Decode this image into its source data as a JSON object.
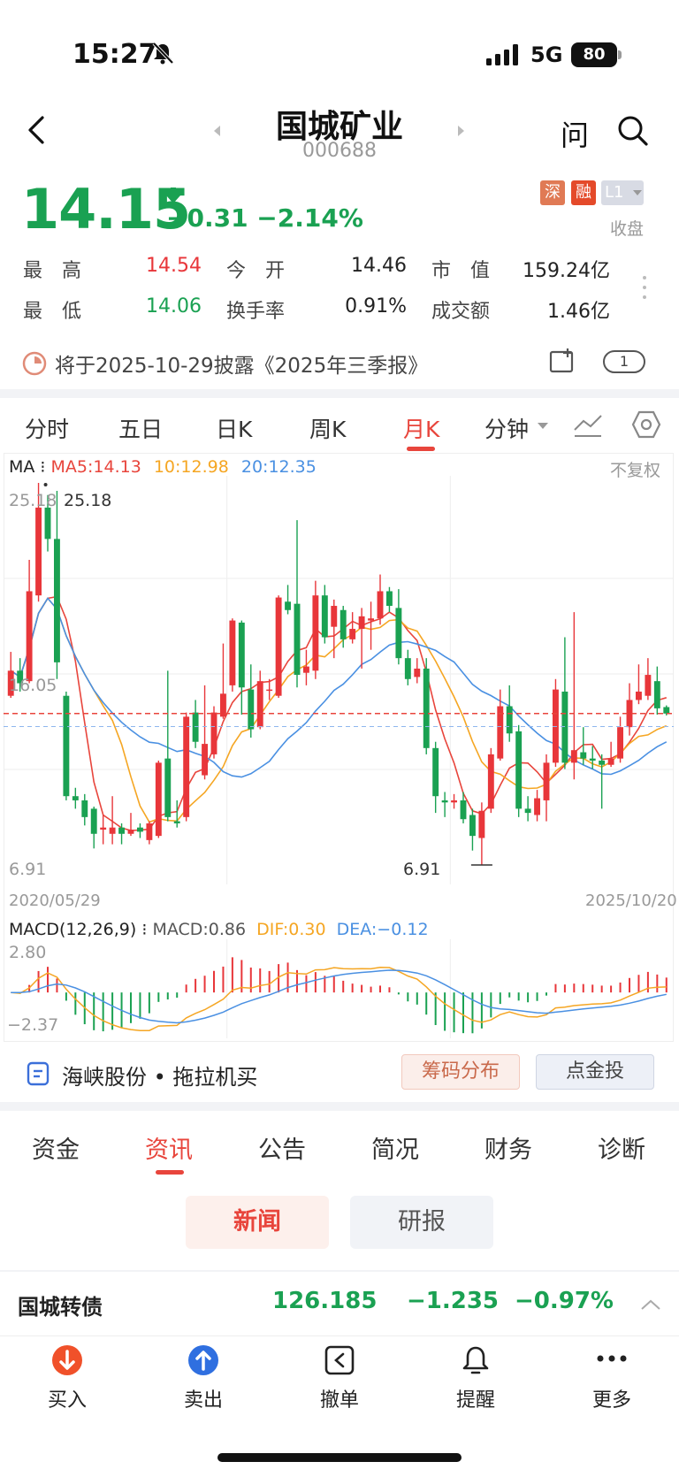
{
  "status_bar": {
    "time": "15:27",
    "network": "5G",
    "battery": "80"
  },
  "header": {
    "title": "国城矿业",
    "code": "000688",
    "ask_label": "问"
  },
  "quote": {
    "price": "14.15",
    "change": "−0.31",
    "change_pct": "−2.14%",
    "tags": [
      "深",
      "融",
      "L1"
    ],
    "market_status": "收盘",
    "stats": [
      {
        "label": "最　高",
        "value": "14.54"
      },
      {
        "label": "今　开",
        "value": "14.46"
      },
      {
        "label": "市　值",
        "value": "159.24亿"
      },
      {
        "label": "最　低",
        "value": "14.06"
      },
      {
        "label": "换手率",
        "value": "0.91%"
      },
      {
        "label": "成交额",
        "value": "1.46亿"
      }
    ]
  },
  "notice": {
    "text": "将于2025-10-29披露《2025年三季报》",
    "pill": "1"
  },
  "chart_tabs": [
    "分时",
    "五日",
    "日K",
    "周K",
    "月K",
    "分钟"
  ],
  "ma_legend": {
    "prefix": "MA",
    "ma5": "MA5:14.13",
    "ma10": "10:12.98",
    "ma20": "20:12.35",
    "adjust": "不复权"
  },
  "chart_axis": {
    "top": "25.18",
    "mid": "16.05",
    "bottom": "6.91",
    "high_mark": "25.18",
    "low_mark": "6.91",
    "start_date": "2020/05/29",
    "end_date": "2025/10/20"
  },
  "macd_legend": {
    "name": "MACD(12,26,9)",
    "macd": "MACD:0.86",
    "dif": "DIF:0.30",
    "dea": "DEA:−0.12",
    "top": "2.80",
    "bottom": "−2.37"
  },
  "colors": {
    "up": "#e8363a",
    "down": "#1aa152",
    "ma5": "#e8453c",
    "ma10": "#f5a623",
    "ma20": "#4a90e2",
    "accent": "#e8453c"
  },
  "chart_data": {
    "type": "candlestick",
    "title": "",
    "period": "monthly",
    "x_range": [
      "2020/05/29",
      "2025/10/20"
    ],
    "ylim": [
      6.91,
      25.18
    ],
    "candles": [
      {
        "o": 15.0,
        "c": 16.2,
        "h": 17.1,
        "l": 14.9
      },
      {
        "o": 16.2,
        "c": 15.6,
        "h": 16.8,
        "l": 15.2
      },
      {
        "o": 15.7,
        "c": 20.0,
        "h": 21.5,
        "l": 15.6
      },
      {
        "o": 19.8,
        "c": 24.0,
        "h": 25.18,
        "l": 19.5
      },
      {
        "o": 24.0,
        "c": 22.5,
        "h": 24.6,
        "l": 21.9
      },
      {
        "o": 22.5,
        "c": 16.6,
        "h": 24.8,
        "l": 15.8
      },
      {
        "o": 15.0,
        "c": 10.2,
        "h": 15.2,
        "l": 10.0
      },
      {
        "o": 10.2,
        "c": 10.0,
        "h": 10.6,
        "l": 9.6
      },
      {
        "o": 10.0,
        "c": 9.2,
        "h": 10.3,
        "l": 8.8
      },
      {
        "o": 9.6,
        "c": 8.4,
        "h": 9.7,
        "l": 7.7
      },
      {
        "o": 8.6,
        "c": 8.7,
        "h": 9.3,
        "l": 7.9
      },
      {
        "o": 8.4,
        "c": 8.7,
        "h": 10.2,
        "l": 7.9
      },
      {
        "o": 8.7,
        "c": 8.4,
        "h": 8.9,
        "l": 7.9
      },
      {
        "o": 8.4,
        "c": 8.6,
        "h": 9.4,
        "l": 8.3
      },
      {
        "o": 8.7,
        "c": 8.5,
        "h": 8.9,
        "l": 8.2
      },
      {
        "o": 8.1,
        "c": 8.9,
        "h": 9.0,
        "l": 7.9
      },
      {
        "o": 8.3,
        "c": 11.8,
        "h": 11.9,
        "l": 8.2
      },
      {
        "o": 12.0,
        "c": 9.2,
        "h": 16.2,
        "l": 9.0
      },
      {
        "o": 9.0,
        "c": 8.9,
        "h": 10.0,
        "l": 8.7
      },
      {
        "o": 9.2,
        "c": 14.0,
        "h": 14.2,
        "l": 9.0
      },
      {
        "o": 14.2,
        "c": 12.8,
        "h": 14.8,
        "l": 12.5
      },
      {
        "o": 11.2,
        "c": 12.7,
        "h": 15.5,
        "l": 11.0
      },
      {
        "o": 12.2,
        "c": 14.2,
        "h": 14.5,
        "l": 12.0
      },
      {
        "o": 14.0,
        "c": 15.1,
        "h": 17.5,
        "l": 13.9
      },
      {
        "o": 15.5,
        "c": 18.6,
        "h": 18.7,
        "l": 15.2
      },
      {
        "o": 18.5,
        "c": 15.4,
        "h": 18.6,
        "l": 14.1
      },
      {
        "o": 15.3,
        "c": 13.4,
        "h": 16.5,
        "l": 13.0
      },
      {
        "o": 13.5,
        "c": 15.7,
        "h": 16.2,
        "l": 13.4
      },
      {
        "o": 15.3,
        "c": 15.3,
        "h": 15.8,
        "l": 14.8
      },
      {
        "o": 15.0,
        "c": 19.7,
        "h": 19.8,
        "l": 14.9
      },
      {
        "o": 19.5,
        "c": 19.1,
        "h": 20.3,
        "l": 18.9
      },
      {
        "o": 19.4,
        "c": 16.0,
        "h": 23.4,
        "l": 15.4
      },
      {
        "o": 16.1,
        "c": 16.4,
        "h": 17.2,
        "l": 15.5
      },
      {
        "o": 16.2,
        "c": 19.8,
        "h": 20.5,
        "l": 15.8
      },
      {
        "o": 19.8,
        "c": 17.8,
        "h": 20.3,
        "l": 17.5
      },
      {
        "o": 18.3,
        "c": 19.3,
        "h": 19.6,
        "l": 16.8
      },
      {
        "o": 19.1,
        "c": 17.7,
        "h": 19.3,
        "l": 17.3
      },
      {
        "o": 17.7,
        "c": 18.2,
        "h": 19.0,
        "l": 17.5
      },
      {
        "o": 18.2,
        "c": 18.8,
        "h": 19.2,
        "l": 16.3
      },
      {
        "o": 18.6,
        "c": 18.7,
        "h": 19.5,
        "l": 17.2
      },
      {
        "o": 18.7,
        "c": 20.0,
        "h": 20.8,
        "l": 18.4
      },
      {
        "o": 20.0,
        "c": 19.3,
        "h": 20.2,
        "l": 19.0
      },
      {
        "o": 19.2,
        "c": 16.8,
        "h": 20.1,
        "l": 16.5
      },
      {
        "o": 16.8,
        "c": 15.8,
        "h": 17.2,
        "l": 15.5
      },
      {
        "o": 15.9,
        "c": 16.3,
        "h": 16.8,
        "l": 15.6
      },
      {
        "o": 16.3,
        "c": 12.5,
        "h": 16.8,
        "l": 12.2
      },
      {
        "o": 12.5,
        "c": 10.2,
        "h": 12.8,
        "l": 9.4
      },
      {
        "o": 10.0,
        "c": 9.9,
        "h": 10.4,
        "l": 9.2
      },
      {
        "o": 9.9,
        "c": 10.0,
        "h": 10.3,
        "l": 9.6
      },
      {
        "o": 10.0,
        "c": 9.1,
        "h": 10.4,
        "l": 8.9
      },
      {
        "o": 9.3,
        "c": 8.3,
        "h": 9.6,
        "l": 7.6
      },
      {
        "o": 8.2,
        "c": 9.5,
        "h": 9.9,
        "l": 6.91
      },
      {
        "o": 9.6,
        "c": 12.2,
        "h": 12.5,
        "l": 9.4
      },
      {
        "o": 12.0,
        "c": 14.5,
        "h": 15.3,
        "l": 11.9
      },
      {
        "o": 14.5,
        "c": 13.2,
        "h": 15.5,
        "l": 12.8
      },
      {
        "o": 13.3,
        "c": 9.6,
        "h": 13.6,
        "l": 9.2
      },
      {
        "o": 9.6,
        "c": 9.4,
        "h": 10.2,
        "l": 9.0
      },
      {
        "o": 9.3,
        "c": 10.1,
        "h": 10.5,
        "l": 9.0
      },
      {
        "o": 10.0,
        "c": 11.8,
        "h": 12.2,
        "l": 9.0
      },
      {
        "o": 11.8,
        "c": 15.3,
        "h": 15.8,
        "l": 11.6
      },
      {
        "o": 15.2,
        "c": 11.8,
        "h": 17.8,
        "l": 11.5
      },
      {
        "o": 11.8,
        "c": 12.4,
        "h": 19.0,
        "l": 11.0
      },
      {
        "o": 12.3,
        "c": 12.0,
        "h": 13.5,
        "l": 11.7
      },
      {
        "o": 12.0,
        "c": 11.9,
        "h": 12.6,
        "l": 11.5
      },
      {
        "o": 11.9,
        "c": 11.7,
        "h": 12.2,
        "l": 9.6
      },
      {
        "o": 11.7,
        "c": 12.0,
        "h": 12.8,
        "l": 11.6
      },
      {
        "o": 12.0,
        "c": 13.5,
        "h": 14.0,
        "l": 11.8
      },
      {
        "o": 13.5,
        "c": 14.8,
        "h": 15.6,
        "l": 13.1
      },
      {
        "o": 14.8,
        "c": 15.2,
        "h": 16.5,
        "l": 14.6
      },
      {
        "o": 15.0,
        "c": 16.0,
        "h": 16.8,
        "l": 14.8
      },
      {
        "o": 15.7,
        "c": 14.4,
        "h": 16.4,
        "l": 14.1
      },
      {
        "o": 14.46,
        "c": 14.15,
        "h": 14.54,
        "l": 14.06
      }
    ],
    "ma5_last": 14.13,
    "ma10_last": 12.98,
    "ma20_last": 12.35,
    "macd_last": {
      "macd": 0.86,
      "dif": 0.3,
      "dea": -0.12
    },
    "macd_ylim": [
      -2.37,
      2.8
    ]
  },
  "promo": {
    "text": "海峡股份 • 拖拉机买",
    "btn1": "筹码分布",
    "btn2": "点金投"
  },
  "news_tabs": [
    "资金",
    "资讯",
    "公告",
    "简况",
    "财务",
    "诊断"
  ],
  "sub_tabs": [
    "新闻",
    "研报"
  ],
  "bond": {
    "name": "国城转债",
    "price": "126.185",
    "change": "−1.235",
    "change_pct": "−0.97%"
  },
  "bottom_nav": [
    "买入",
    "卖出",
    "撤单",
    "提醒",
    "更多"
  ]
}
